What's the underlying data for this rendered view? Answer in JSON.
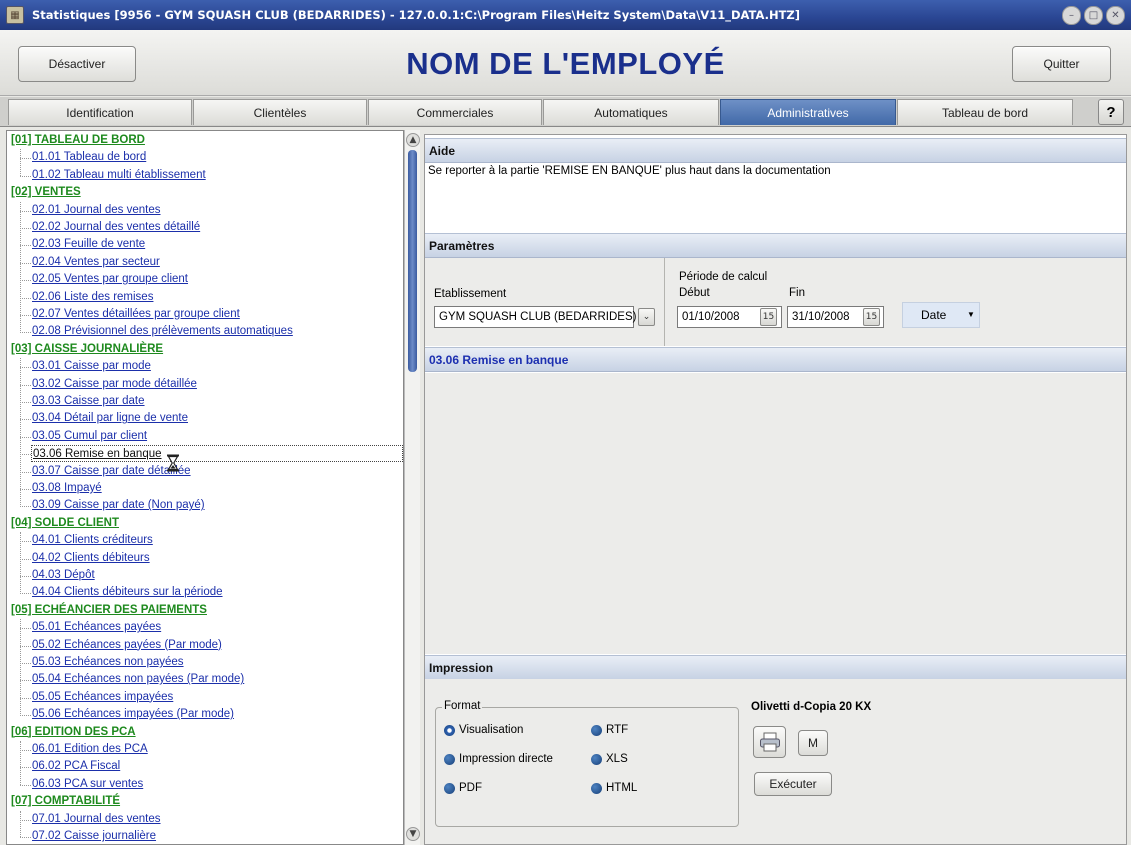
{
  "window": {
    "title": "Statistiques [9956 - GYM SQUASH CLUB (BEDARRIDES) - 127.0.0.1:C:\\Program Files\\Heitz System\\Data\\V11_DATA.HTZ]"
  },
  "header": {
    "desactiver_label": "Désactiver",
    "app_title": "NOM DE L'EMPLOYÉ",
    "quitter_label": "Quitter"
  },
  "tabs": [
    {
      "label": "Identification"
    },
    {
      "label": "Clientèles"
    },
    {
      "label": "Commerciales"
    },
    {
      "label": "Automatiques"
    },
    {
      "label": "Administratives",
      "active": true
    },
    {
      "label": "Tableau de bord"
    }
  ],
  "help_label": "?",
  "tree": {
    "rows": [
      {
        "type": "cat",
        "label": "[01] TABLEAU DE BORD"
      },
      {
        "type": "item",
        "label": "01.01 Tableau de bord"
      },
      {
        "type": "item",
        "label": "01.02 Tableau multi établissement"
      },
      {
        "type": "cat",
        "label": "[02] VENTES"
      },
      {
        "type": "item",
        "label": "02.01 Journal des ventes"
      },
      {
        "type": "item",
        "label": "02.02 Journal des ventes détaillé"
      },
      {
        "type": "item",
        "label": "02.03 Feuille de vente"
      },
      {
        "type": "item",
        "label": "02.04 Ventes par secteur"
      },
      {
        "type": "item",
        "label": "02.05 Ventes par groupe client"
      },
      {
        "type": "item",
        "label": "02.06 Liste des remises"
      },
      {
        "type": "item",
        "label": "02.07 Ventes détaillées par groupe client"
      },
      {
        "type": "item",
        "label": "02.08 Prévisionnel des prélèvements automatiques"
      },
      {
        "type": "cat",
        "label": "[03] CAISSE JOURNALIÈRE"
      },
      {
        "type": "item",
        "label": "03.01 Caisse par mode"
      },
      {
        "type": "item",
        "label": "03.02 Caisse par mode détaillée"
      },
      {
        "type": "item",
        "label": "03.03 Caisse par date"
      },
      {
        "type": "item",
        "label": "03.04 Détail par ligne de vente"
      },
      {
        "type": "item",
        "label": "03.05 Cumul par client"
      },
      {
        "type": "item",
        "label": "03.06 Remise en banque",
        "selected": true
      },
      {
        "type": "item",
        "label": "03.07 Caisse par date détaillée"
      },
      {
        "type": "item",
        "label": "03.08 Impayé"
      },
      {
        "type": "item",
        "label": "03.09 Caisse par date (Non payé)"
      },
      {
        "type": "cat",
        "label": "[04] SOLDE CLIENT"
      },
      {
        "type": "item",
        "label": "04.01 Clients créditeurs"
      },
      {
        "type": "item",
        "label": "04.02 Clients débiteurs"
      },
      {
        "type": "item",
        "label": "04.03 Dépôt"
      },
      {
        "type": "item",
        "label": "04.04 Clients débiteurs sur la période"
      },
      {
        "type": "cat",
        "label": "[05] ECHÉANCIER DES PAIEMENTS"
      },
      {
        "type": "item",
        "label": "05.01 Echéances payées"
      },
      {
        "type": "item",
        "label": "05.02 Echéances payées (Par mode)"
      },
      {
        "type": "item",
        "label": "05.03 Echéances non payées"
      },
      {
        "type": "item",
        "label": "05.04 Echéances non payées (Par mode)"
      },
      {
        "type": "item",
        "label": "05.05 Echéances impayées"
      },
      {
        "type": "item",
        "label": "05.06 Echéances impayées (Par mode)"
      },
      {
        "type": "cat",
        "label": "[06] EDITION DES PCA"
      },
      {
        "type": "item",
        "label": "06.01 Edition des PCA"
      },
      {
        "type": "item",
        "label": "06.02 PCA Fiscal"
      },
      {
        "type": "item",
        "label": "06.03 PCA sur ventes"
      },
      {
        "type": "cat",
        "label": "[07] COMPTABILITÉ"
      },
      {
        "type": "item",
        "label": "07.01 Journal des ventes"
      },
      {
        "type": "item",
        "label": "07.02 Caisse journalière"
      }
    ]
  },
  "aide": {
    "header": "Aide",
    "text": "Se reporter à la partie 'REMISE EN BANQUE' plus haut dans la documentation"
  },
  "parametres": {
    "header": "Paramètres",
    "etablissement_label": "Etablissement",
    "etablissement_value": "GYM SQUASH CLUB (BEDARRIDES)",
    "periode_label": "Période de calcul",
    "debut_label": "Début",
    "debut_value": "01/10/2008",
    "fin_label": "Fin",
    "fin_value": "31/10/2008",
    "calendar_glyph": "15",
    "date_button": "Date"
  },
  "report": {
    "title": "03.06 Remise en banque"
  },
  "impression": {
    "header": "Impression",
    "format_legend": "Format",
    "options": [
      {
        "label": "Visualisation",
        "selected": true
      },
      {
        "label": "Impression directe"
      },
      {
        "label": "PDF"
      },
      {
        "label": "RTF"
      },
      {
        "label": "XLS"
      },
      {
        "label": "HTML"
      }
    ],
    "printer_name": "Olivetti d-Copia 20 KX",
    "m_button": "M",
    "executer_button": "Exécuter"
  },
  "colors": {
    "category": "#1e8a1e",
    "link": "#1b2faa",
    "title": "#1a2f8c",
    "active_tab": "#4169a8"
  }
}
